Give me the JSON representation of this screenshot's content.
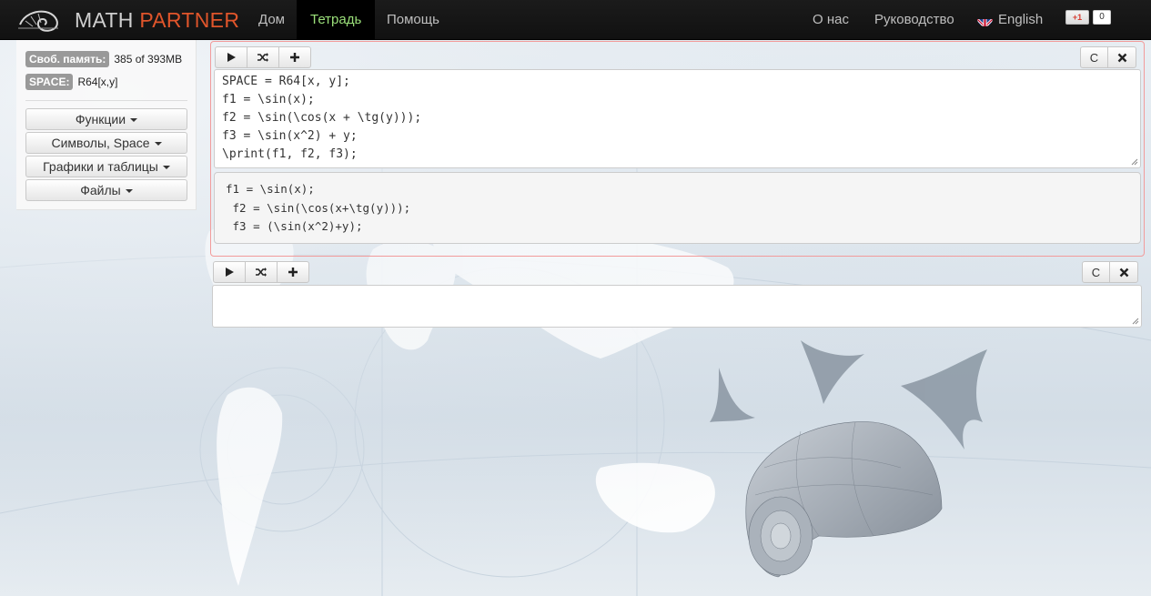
{
  "brand": {
    "math": "MATH",
    "partner": "PARTNER",
    "logo_icon": "nautilus-shell-icon"
  },
  "nav": {
    "left": [
      {
        "label": "Дом",
        "active": false
      },
      {
        "label": "Тетрадь",
        "active": true
      },
      {
        "label": "Помощь",
        "active": false
      }
    ],
    "right": {
      "about": "О нас",
      "guide": "Руководство",
      "language": "English",
      "gplus_label": "+1",
      "gplus_count": "0"
    }
  },
  "sidebar": {
    "memory_label": "Своб. память:",
    "memory_value": "385 of 393MB",
    "space_label": "SPACE:",
    "space_value": "R64[x,y]",
    "buttons": [
      "Функции",
      "Символы, Space",
      "Графики и таблицы",
      "Файлы"
    ]
  },
  "cells": [
    {
      "input": "SPACE = R64[x, y];\nf1 = \\sin(x);\nf2 = \\sin(\\cos(x + \\tg(y)));\nf3 = \\sin(x^2) + y;\n\\print(f1, f2, f3);",
      "output": "f1 = \\sin(x);\n f2 = \\sin(\\cos(x+\\tg(y)));\n f3 = (\\sin(x^2)+y);",
      "clear_label": "C"
    },
    {
      "input": "",
      "clear_label": "C"
    }
  ],
  "colors": {
    "accent_active_nav": "#9be07a",
    "brand_partner": "#e0552b",
    "active_cell_border": "#f29b9b"
  }
}
